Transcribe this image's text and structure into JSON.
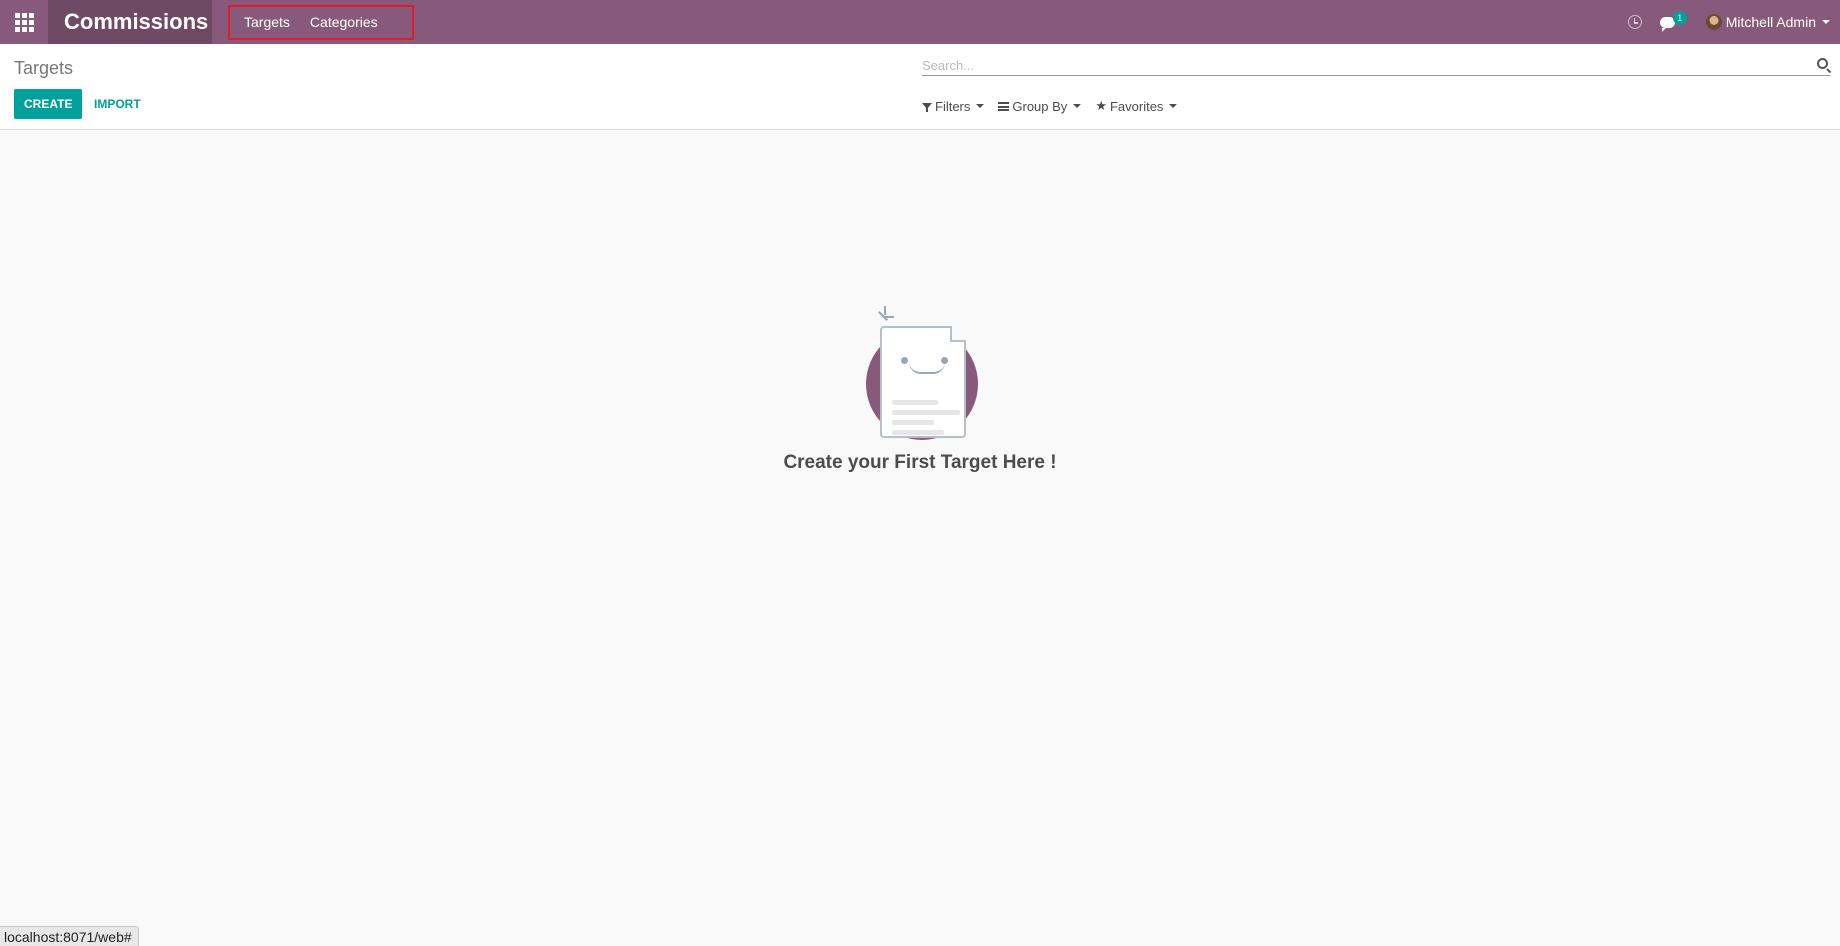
{
  "navbar": {
    "app_name": "Commissions",
    "menu": [
      {
        "label": "Targets"
      },
      {
        "label": "Categories"
      }
    ],
    "messages_count": "1",
    "user_name": "Mitchell Admin"
  },
  "control_panel": {
    "breadcrumb": "Targets",
    "create_label": "CREATE",
    "import_label": "IMPORT",
    "search_placeholder": "Search...",
    "filters_label": "Filters",
    "group_by_label": "Group By",
    "favorites_label": "Favorites"
  },
  "empty_state": {
    "title": "Create your First Target Here !"
  },
  "status_bar": {
    "url": "localhost:8071/web#"
  },
  "colors": {
    "brand": "#875a7b",
    "brand_dark": "#6f4a64",
    "accent": "#00a09d",
    "highlight": "#e11b2b"
  }
}
